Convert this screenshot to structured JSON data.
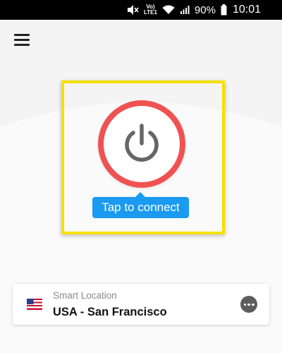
{
  "status_bar": {
    "volte_line1": "Vo)",
    "volte_line2": "LTE1",
    "battery": "90%",
    "time": "10:01",
    "icons": [
      "mute-icon",
      "volte-icon",
      "wifi-icon",
      "signal-icon",
      "battery-icon"
    ]
  },
  "header": {
    "menu_icon": "hamburger-menu-icon"
  },
  "connect": {
    "power_icon": "power-icon",
    "tip_label": "Tap to connect",
    "ring_color": "#f05252",
    "tip_color": "#1a9af0",
    "highlight_color": "#f5e000"
  },
  "location": {
    "label": "Smart Location",
    "name": "USA - San Francisco",
    "flag_icon": "us-flag-icon",
    "more_icon": "more-options-icon"
  }
}
